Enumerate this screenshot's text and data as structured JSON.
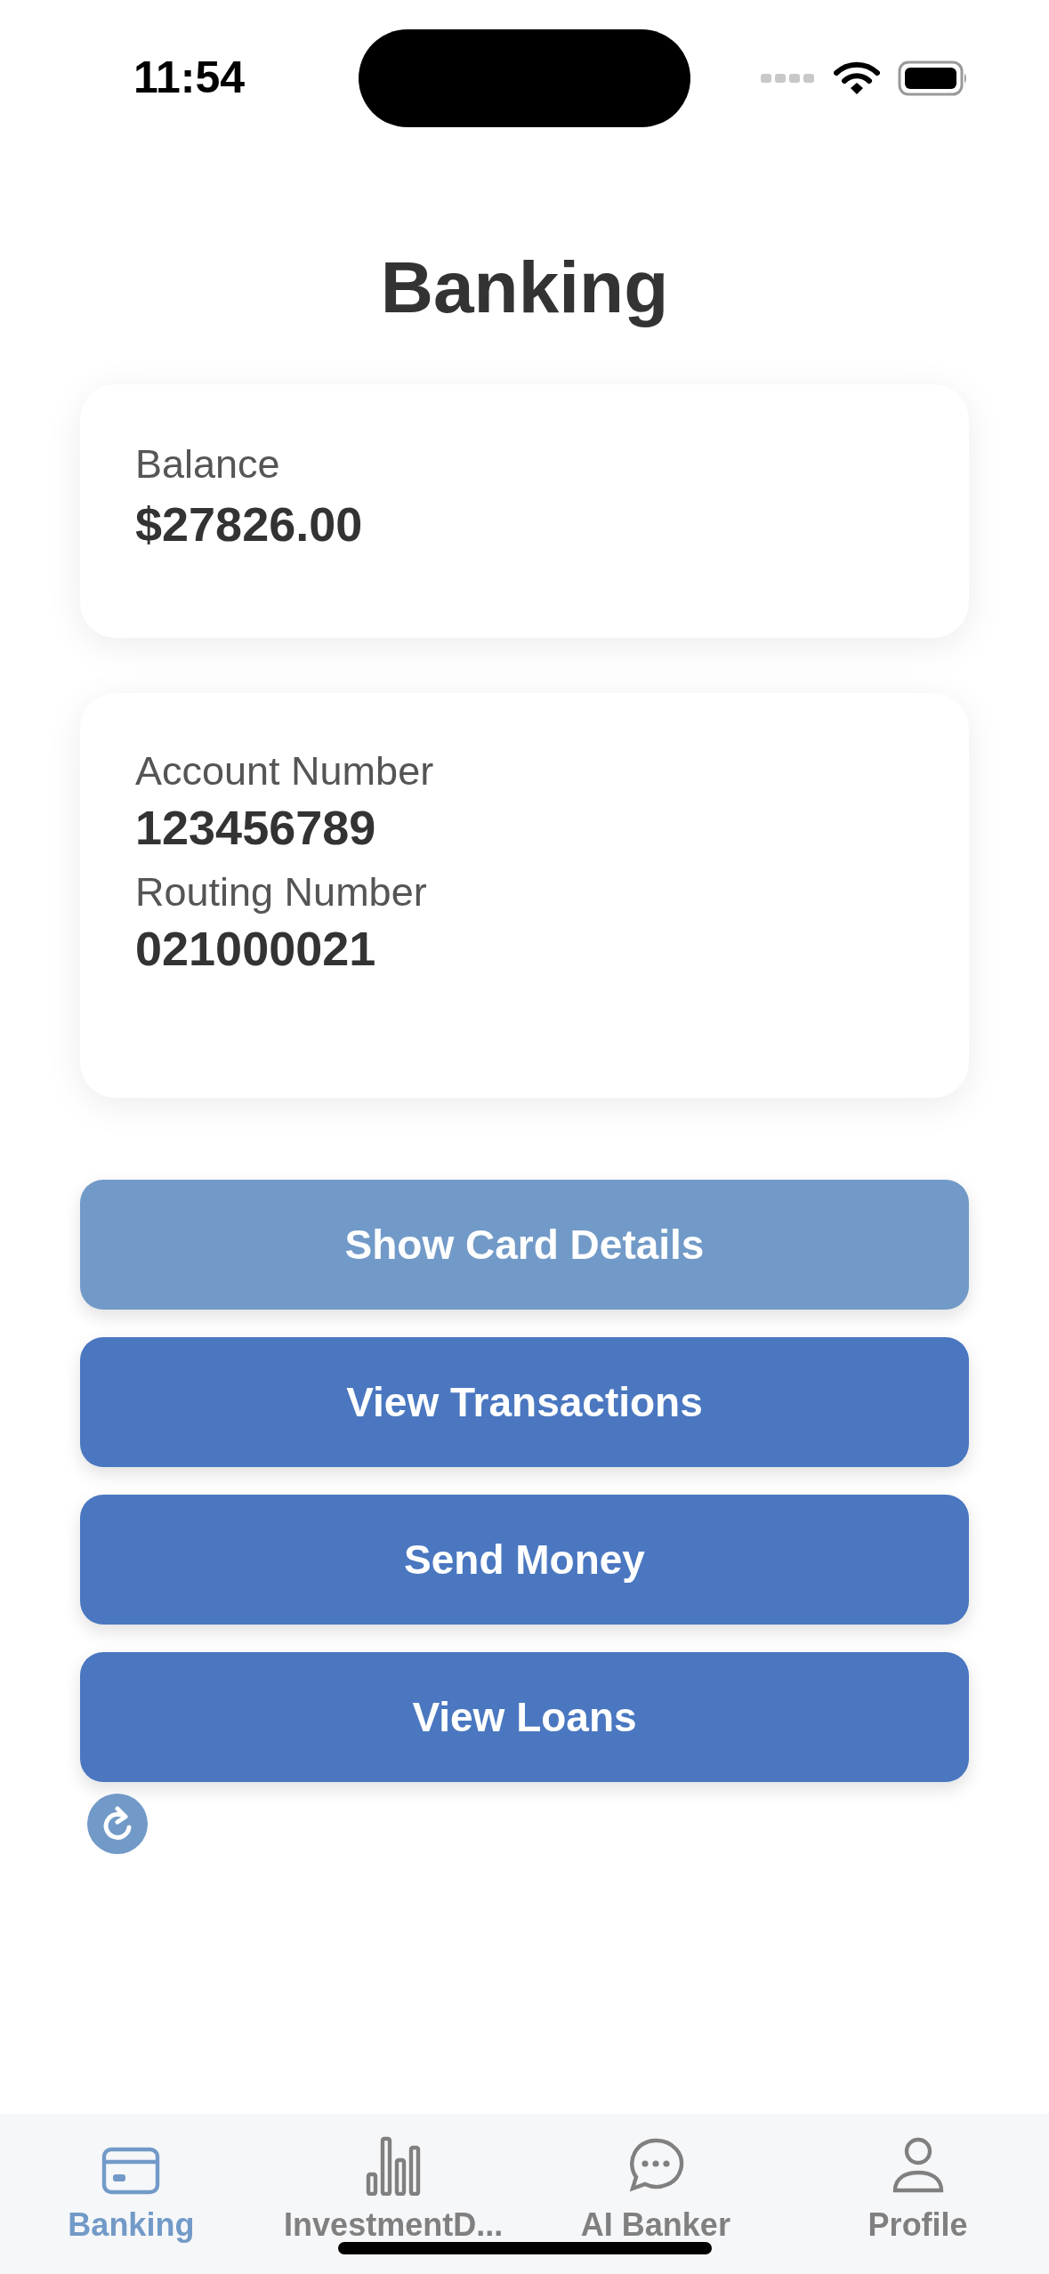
{
  "status_bar": {
    "time": "11:54"
  },
  "title": "Banking",
  "balance_card": {
    "label": "Balance",
    "value": "$27826.00"
  },
  "account_card": {
    "fields": [
      {
        "label": "Account Number",
        "value": "123456789"
      },
      {
        "label": "Routing Number",
        "value": "021000021"
      }
    ]
  },
  "buttons": [
    {
      "label": "Show Card Details",
      "disabled": true
    },
    {
      "label": "View Transactions",
      "disabled": false
    },
    {
      "label": "Send Money",
      "disabled": false
    },
    {
      "label": "View Loans",
      "disabled": false
    }
  ],
  "tabs": [
    {
      "label": "Banking",
      "kind": "card",
      "selected": true
    },
    {
      "label": "InvestmentD...",
      "kind": "chart",
      "selected": false
    },
    {
      "label": "AI Banker",
      "kind": "chat",
      "selected": false
    },
    {
      "label": "Profile",
      "kind": "person",
      "selected": false
    }
  ]
}
